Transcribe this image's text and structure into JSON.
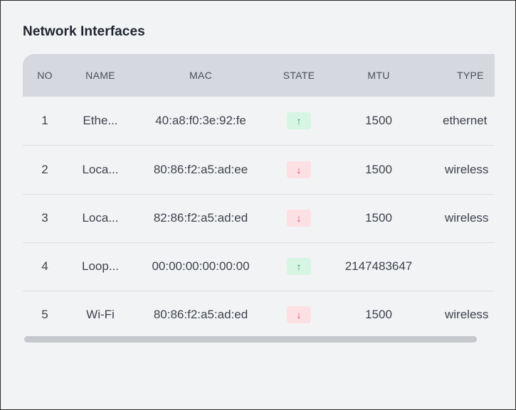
{
  "title": "Network Interfaces",
  "columns": {
    "no": "NO",
    "name": "NAME",
    "mac": "MAC",
    "state": "STATE",
    "mtu": "MTU",
    "type": "TYPE"
  },
  "rows": [
    {
      "no": "1",
      "name": "Ethe...",
      "mac": "40:a8:f0:3e:92:fe",
      "state": "up",
      "state_icon": "arrow-up-icon",
      "mtu": "1500",
      "type": "ethernet"
    },
    {
      "no": "2",
      "name": "Loca...",
      "mac": "80:86:f2:a5:ad:ee",
      "state": "down",
      "state_icon": "arrow-down-icon",
      "mtu": "1500",
      "type": "wireless"
    },
    {
      "no": "3",
      "name": "Loca...",
      "mac": "82:86:f2:a5:ad:ed",
      "state": "down",
      "state_icon": "arrow-down-icon",
      "mtu": "1500",
      "type": "wireless"
    },
    {
      "no": "4",
      "name": "Loop...",
      "mac": "00:00:00:00:00:00",
      "state": "up",
      "state_icon": "arrow-up-icon",
      "mtu": "2147483647",
      "type": ""
    },
    {
      "no": "5",
      "name": "Wi-Fi",
      "mac": "80:86:f2:a5:ad:ed",
      "state": "down",
      "state_icon": "arrow-down-icon",
      "mtu": "1500",
      "type": "wireless"
    }
  ],
  "colors": {
    "state_up_bg": "#d6f5e3",
    "state_up_fg": "#1f9a5a",
    "state_down_bg": "#fde0e3",
    "state_down_fg": "#d94458",
    "header_bg": "#d5d8de"
  }
}
